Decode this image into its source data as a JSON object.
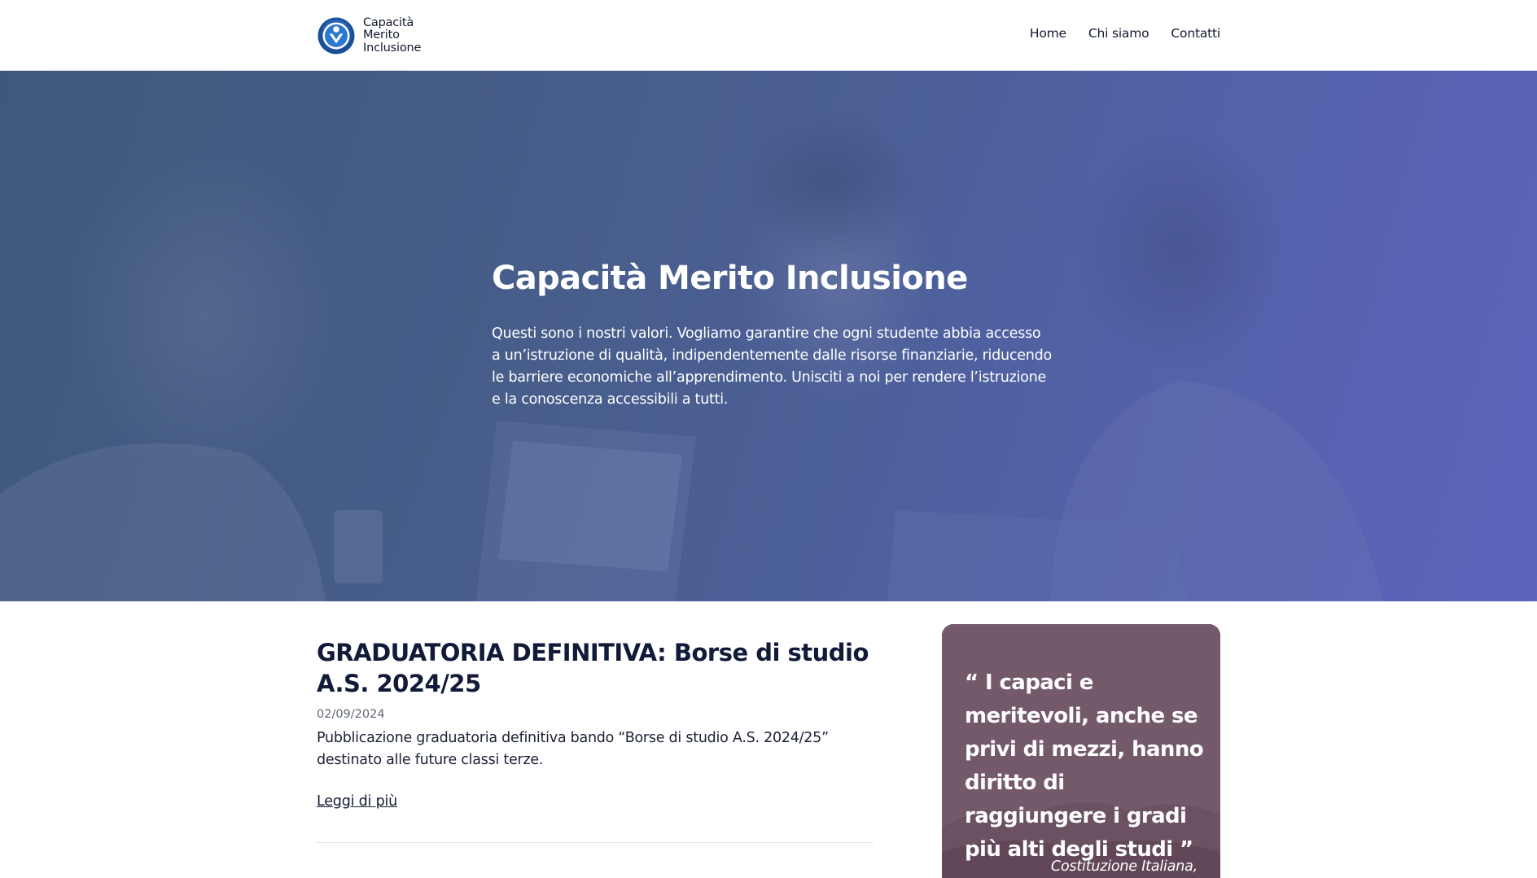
{
  "brand": {
    "lines": [
      "Capacità",
      "Merito",
      "Inclusione"
    ],
    "primary_color": "#1f5fb0"
  },
  "nav": {
    "items": [
      {
        "label": "Home"
      },
      {
        "label": "Chi siamo"
      },
      {
        "label": "Contatti"
      }
    ]
  },
  "hero": {
    "title": "Capacità Merito Inclusione",
    "text": "Questi sono i nostri valori. Vogliamo garantire che ogni studente abbia accesso a un’istruzione di qualità, indipendentemente dalle risorse finanziarie, riducendo le barriere economiche all’apprendimento. Unisciti a noi per rendere l’istruzione e la conoscenza accessibili a tutti.",
    "overlay_color": "#4e62a0"
  },
  "article": {
    "title": "GRADUATORIA DEFINITIVA: Borse di studio A.S. 2024/25",
    "date": "02/09/2024",
    "excerpt": "Pubblicazione graduatoria definitiva bando “Borse di studio A.S. 2024/25” destinato alle future classi terze.",
    "read_more": "Leggi di più"
  },
  "quote": {
    "text": "“ I capaci e meritevoli, anche se privi di mezzi, hanno diritto di raggiungere i gradi più alti degli studi ”",
    "source": "Costituzione Italiana,",
    "card_color": "#74596a"
  }
}
